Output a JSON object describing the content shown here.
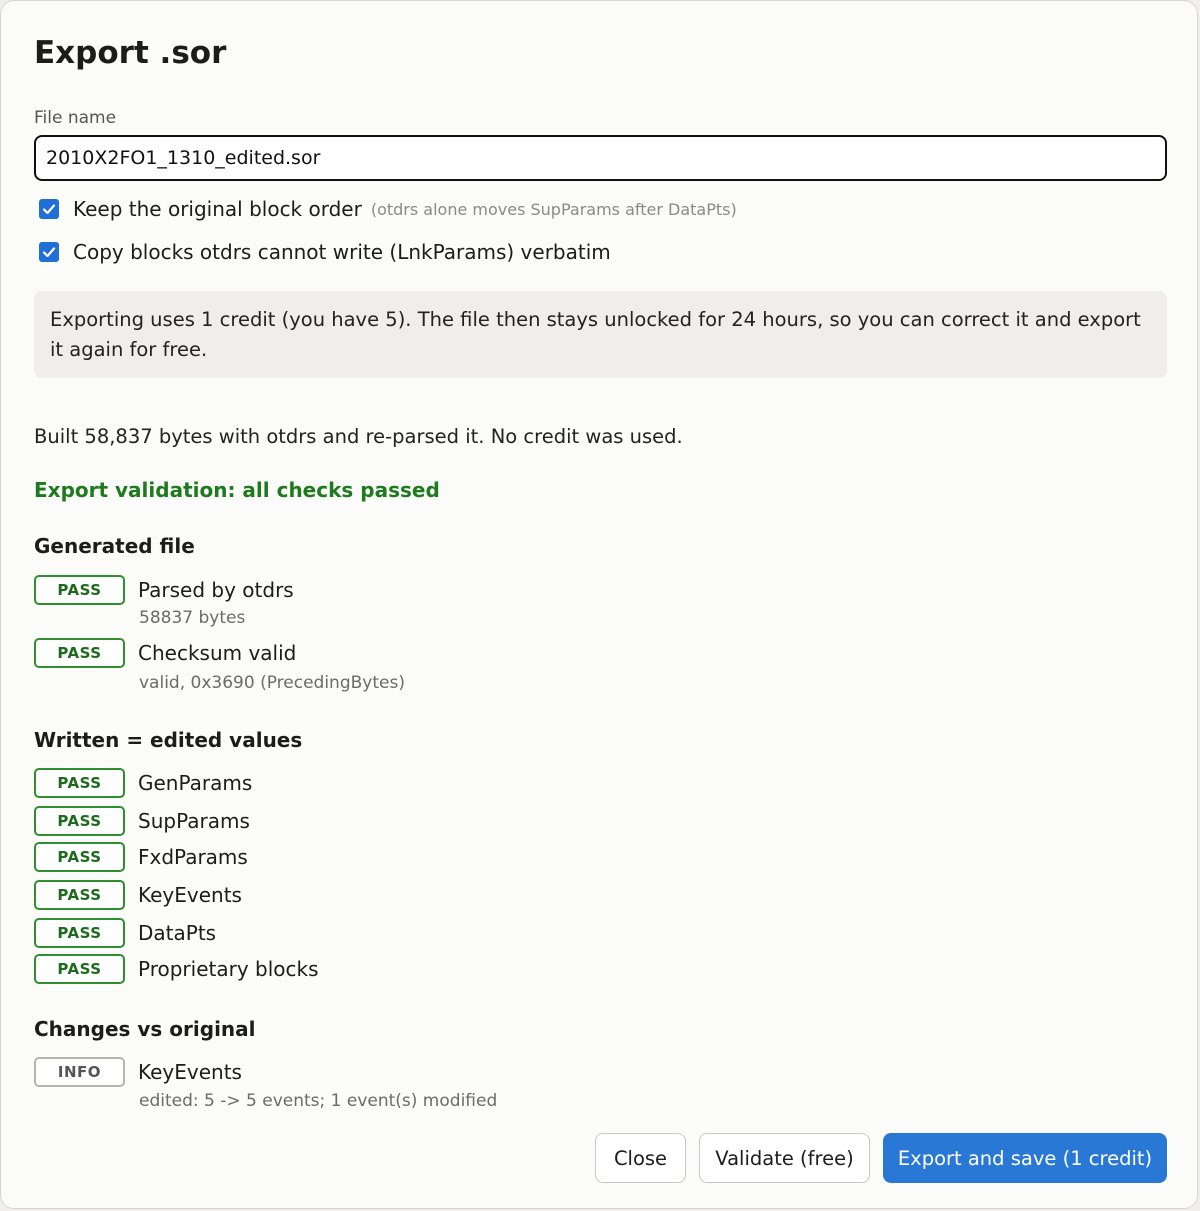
{
  "dialog": {
    "title": "Export .sor"
  },
  "file": {
    "label": "File name",
    "value": "2010X2FO1_1310_edited.sor"
  },
  "options": [
    {
      "label": "Keep the original block order",
      "hint": "(otdrs alone moves SupParams after DataPts)",
      "checked": true
    },
    {
      "label": "Copy blocks otdrs cannot write (LnkParams) verbatim",
      "hint": "",
      "checked": true
    }
  ],
  "notice": {
    "text": "Exporting uses 1 credit (you have 5). The file then stays unlocked for 24 hours, so you can correct it and export it again for free."
  },
  "status": {
    "built": "Built 58,837 bytes with otdrs and re-parsed it. No credit was used.",
    "validation": "Export validation: all checks passed"
  },
  "sections": {
    "generated": {
      "heading": "Generated file",
      "items": [
        {
          "badge": "PASS",
          "label": "Parsed by otdrs",
          "sub": "58837 bytes"
        },
        {
          "badge": "PASS",
          "label": "Checksum valid",
          "sub": "valid, 0x3690 (PrecedingBytes)"
        }
      ]
    },
    "written": {
      "heading": "Written = edited values",
      "items": [
        {
          "badge": "PASS",
          "label": "GenParams"
        },
        {
          "badge": "PASS",
          "label": "SupParams"
        },
        {
          "badge": "PASS",
          "label": "FxdParams"
        },
        {
          "badge": "PASS",
          "label": "KeyEvents"
        },
        {
          "badge": "PASS",
          "label": "DataPts"
        },
        {
          "badge": "PASS",
          "label": "Proprietary blocks"
        }
      ]
    },
    "changes": {
      "heading": "Changes vs original",
      "items": [
        {
          "badge": "INFO",
          "label": "KeyEvents",
          "sub": "edited: 5 -> 5 events; 1 event(s) modified"
        }
      ]
    }
  },
  "buttons": {
    "close": "Close",
    "validate": "Validate (free)",
    "export": "Export and save (1 credit)"
  },
  "colors": {
    "accent": "#2a78d6",
    "pass": "#2f8f2f",
    "success_text": "#1d7a1d"
  }
}
